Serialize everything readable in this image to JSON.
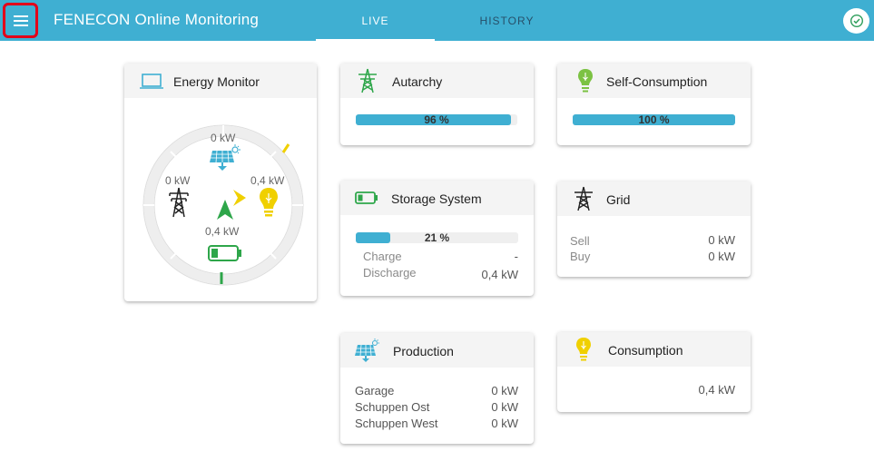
{
  "header": {
    "title": "FENECON Online Monitoring",
    "tabs": [
      {
        "label": "LIVE",
        "active": true
      },
      {
        "label": "HISTORY",
        "active": false
      }
    ],
    "menu_icon": "menu-icon",
    "status_icon": "check-circle-icon",
    "brand_color": "#3fafd2"
  },
  "energy_monitor": {
    "title": "Energy Monitor",
    "production": "0 kW",
    "grid": "0 kW",
    "consumption": "0,4 kW",
    "storage": "0,4 kW"
  },
  "autarchy": {
    "title": "Autarchy",
    "percent": 96,
    "label": "96 %"
  },
  "self_consumption": {
    "title": "Self-Consumption",
    "percent": 100,
    "label": "100 %"
  },
  "storage_system": {
    "title": "Storage System",
    "percent": 21,
    "label": "21 %",
    "charge_label": "Charge",
    "charge_value": "-",
    "discharge_label": "Discharge",
    "discharge_value": "0,4 kW"
  },
  "grid": {
    "title": "Grid",
    "sell_label": "Sell",
    "sell_value": "0 kW",
    "buy_label": "Buy",
    "buy_value": "0 kW"
  },
  "production": {
    "title": "Production",
    "rows": [
      {
        "label": "Garage",
        "value": "0 kW"
      },
      {
        "label": "Schuppen Ost",
        "value": "0 kW"
      },
      {
        "label": "Schuppen West",
        "value": "0 kW"
      }
    ]
  },
  "consumption": {
    "title": "Consumption",
    "value": "0,4 kW"
  }
}
